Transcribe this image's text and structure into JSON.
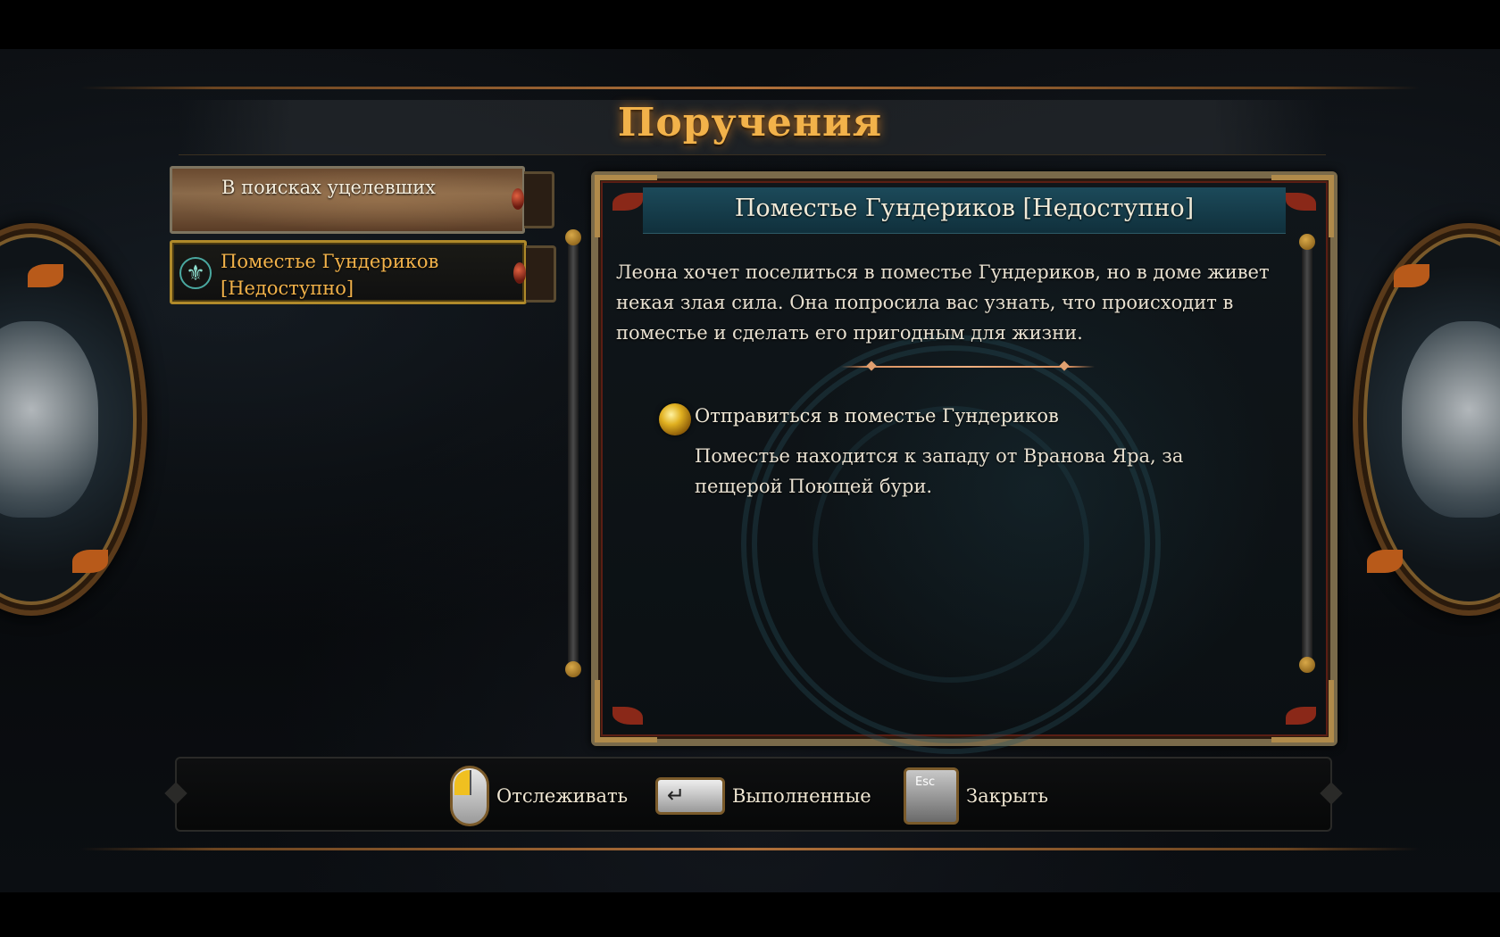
{
  "screen": {
    "title": "Поручения"
  },
  "quests": [
    {
      "label": "В поисках уцелевших",
      "state": "inactive"
    },
    {
      "label": "Поместье Гундериков [Недоступно]",
      "state": "selected",
      "icon": "fleur-de-lis-icon"
    }
  ],
  "detail": {
    "title": "Поместье Гундериков [Недоступно]",
    "description": "Леона хочет поселиться в поместье Гундериков, но в доме живет некая злая сила. Она попросила вас узнать, что происходит в поместье и сделать его пригодным для жизни.",
    "objective": {
      "title": "Отправиться в поместье Гундериков",
      "description": "Поместье находится к западу от Вранова Яра, за пещерой Поющей бури."
    }
  },
  "footer": {
    "track": {
      "key": "mouse-left-click-icon",
      "label": "Отслеживать"
    },
    "completed": {
      "key": "enter-key-icon",
      "key_text": "↵",
      "label": "Выполненные"
    },
    "close": {
      "key": "esc-key-icon",
      "key_text": "Esc",
      "label": "Закрыть"
    }
  },
  "colors": {
    "title": "#f2b24a",
    "selected_text": "#f2b24a",
    "body_text": "#e8e0d0",
    "header_band": "#1c4a5a",
    "frame": "#7a6a4a"
  }
}
